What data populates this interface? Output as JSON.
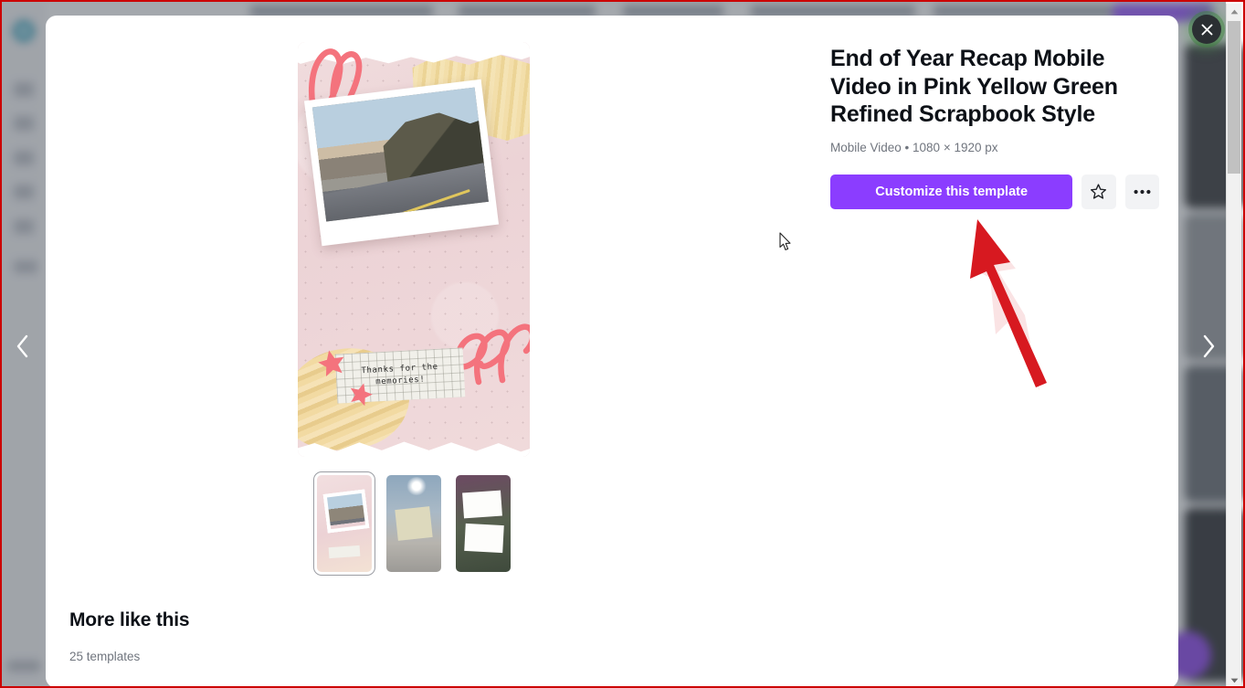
{
  "modal": {
    "close_label": "×",
    "prev_label": "‹",
    "next_label": "›"
  },
  "preview": {
    "artwork_note_text": "Thanks for the memories!",
    "alt_label": "template-preview"
  },
  "thumbnails": [
    {
      "label": "thumbnail-1",
      "selected": true
    },
    {
      "label": "thumbnail-2",
      "selected": false
    },
    {
      "label": "thumbnail-3",
      "selected": false
    }
  ],
  "info": {
    "title": "End of Year Recap Mobile Video in Pink Yellow Green Refined Scrapbook Style",
    "meta": "Mobile Video • 1080 × 1920 px",
    "customize_label": "Customize this template",
    "star_icon": "star-outline-icon",
    "more_icon": "ellipsis-icon"
  },
  "more_section": {
    "title": "More like this",
    "count": "25 templates"
  },
  "colors": {
    "brand_purple": "#8b3dff",
    "annotation_red": "#d71920",
    "text_primary": "#0d1117",
    "text_muted": "#70757e",
    "overlay": "rgba(90,96,106,0.55)"
  },
  "scrollbar": {
    "up_label": "▲",
    "down_label": "▼"
  }
}
